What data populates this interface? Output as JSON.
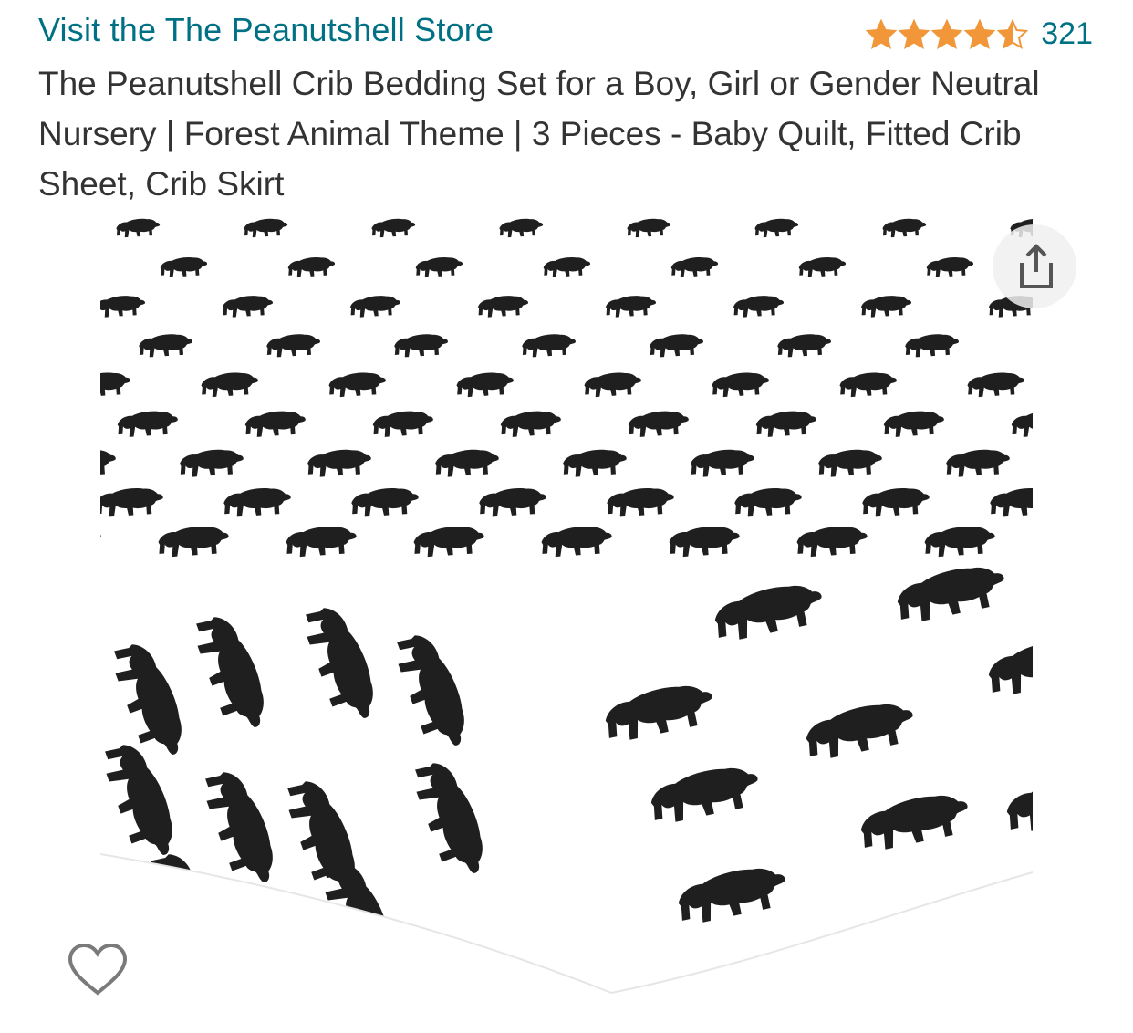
{
  "header": {
    "store_link": "Visit the The Peanutshell Store",
    "rating_count": "321",
    "rating_stars": 4.5
  },
  "product": {
    "title": "The Peanutshell Crib Bedding Set for a Boy, Girl or Gender Neutral Nursery | Forest Animal Theme | 3 Pieces - Baby Quilt, Fitted Crib Sheet, Crib Skirt"
  },
  "colors": {
    "link": "#007185",
    "star": "#F1973A",
    "title_text": "#333333",
    "print": "#1f1f1f"
  },
  "icons": {
    "share": "share-icon",
    "favorite": "heart-icon"
  }
}
